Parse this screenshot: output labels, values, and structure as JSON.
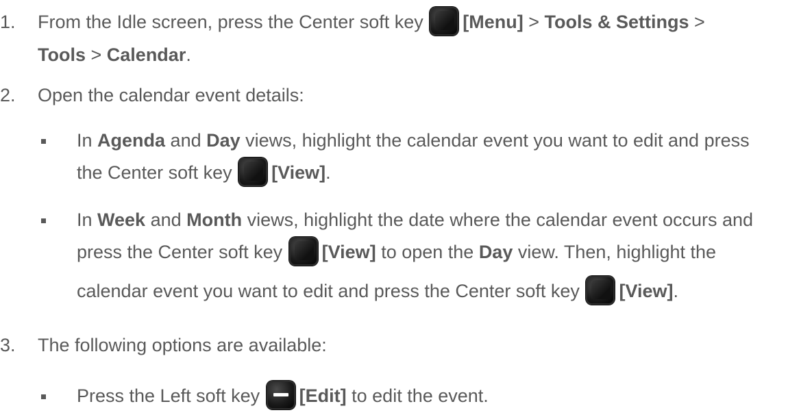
{
  "steps": {
    "s1": {
      "num": "1.",
      "line1_pre": "From the Idle screen, press the Center soft key",
      "line1_menu": "[Menu]",
      "line1_gt1": " > ",
      "line1_tools_settings": "Tools & Settings",
      "line1_gt2": " >",
      "line2_tools": "Tools",
      "line2_gt": " > ",
      "line2_calendar": "Calendar",
      "line2_end": "."
    },
    "s2": {
      "num": "2.",
      "text": "Open the calendar event details:",
      "b1": {
        "in": "In ",
        "agenda": "Agenda",
        "and": " and ",
        "day": "Day",
        "rest": " views, highlight the calendar event you want to edit and press",
        "line2_pre": "the Center soft key",
        "view": "[View]",
        "end": "."
      },
      "b2": {
        "in": "In ",
        "week": "Week",
        "and": " and ",
        "month": "Month",
        "rest": " views, highlight the date where the calendar event occurs and",
        "line2_pre": "press the Center soft key",
        "view": "[View]",
        "mid": " to open the ",
        "day": "Day",
        "mid2": " view. Then, highlight the",
        "line3_pre": "calendar event you want to edit and press the Center soft key",
        "view2": "[View]",
        "end": "."
      }
    },
    "s3": {
      "num": "3.",
      "text": "The following options are available:",
      "b1": {
        "pre": "Press the Left soft key",
        "edit": "[Edit]",
        "post": " to edit the event."
      }
    }
  },
  "icons": {
    "center_key": "center-soft-key-icon",
    "left_key": "left-soft-key-icon"
  }
}
